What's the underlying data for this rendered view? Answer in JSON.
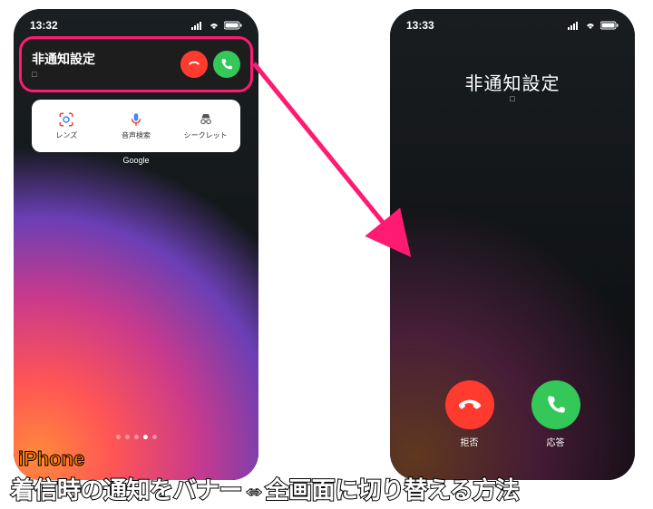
{
  "left_phone": {
    "status_time": "13:32",
    "caller_name": "非通知設定",
    "caller_sub": "□",
    "widget": {
      "items": [
        {
          "label": "レンズ"
        },
        {
          "label": "音声検索"
        },
        {
          "label": "シークレット"
        }
      ],
      "title": "Google"
    }
  },
  "right_phone": {
    "status_time": "13:33",
    "caller_name": "非通知設定",
    "caller_sub": "□",
    "decline_label": "拒否",
    "answer_label": "応答"
  },
  "captions": {
    "iphone": "iPhone",
    "main": "着信時の通知をバナー⇔全画面に切り替える方法"
  },
  "colors": {
    "decline": "#ff3b30",
    "answer": "#34c759",
    "highlight": "#ff1a72",
    "iphone_label": "#ff7a00"
  }
}
